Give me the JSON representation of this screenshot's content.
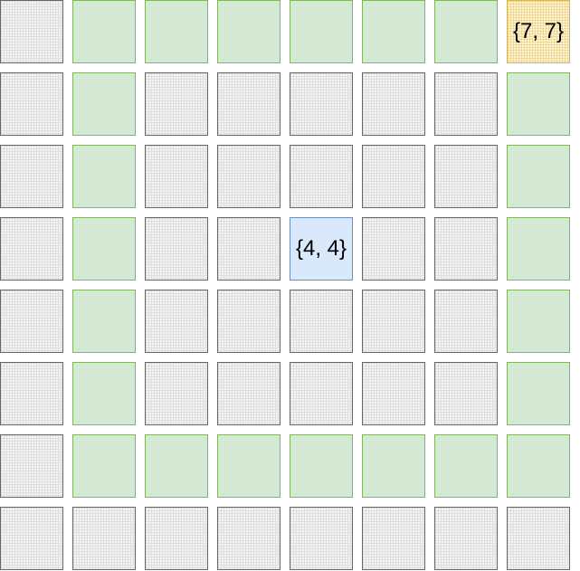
{
  "grid": {
    "rows": 8,
    "cols": 8,
    "colors": {
      "default_fill": "#f5f5f5",
      "default_stroke": "#666666",
      "path_fill": "#d5e8d4",
      "path_stroke": "#82b366",
      "start_fill": "#dae8fc",
      "start_stroke": "#6c8ebf",
      "goal_fill": "#fff2cc",
      "goal_stroke": "#d6b656"
    },
    "cells": [
      [
        "default",
        "path",
        "path",
        "path",
        "path",
        "path",
        "path",
        "goal"
      ],
      [
        "default",
        "path",
        "default",
        "default",
        "default",
        "default",
        "default",
        "path"
      ],
      [
        "default",
        "path",
        "default",
        "default",
        "default",
        "default",
        "default",
        "path"
      ],
      [
        "default",
        "path",
        "default",
        "default",
        "start",
        "default",
        "default",
        "path"
      ],
      [
        "default",
        "path",
        "default",
        "default",
        "default",
        "default",
        "default",
        "path"
      ],
      [
        "default",
        "path",
        "default",
        "default",
        "default",
        "default",
        "default",
        "path"
      ],
      [
        "default",
        "path",
        "path",
        "path",
        "path",
        "path",
        "path",
        "path"
      ],
      [
        "default",
        "default",
        "default",
        "default",
        "default",
        "default",
        "default",
        "default"
      ]
    ],
    "labels": [
      {
        "row": 0,
        "col": 7,
        "text": "{7, 7}"
      },
      {
        "row": 3,
        "col": 4,
        "text": "{4, 4}"
      }
    ]
  }
}
